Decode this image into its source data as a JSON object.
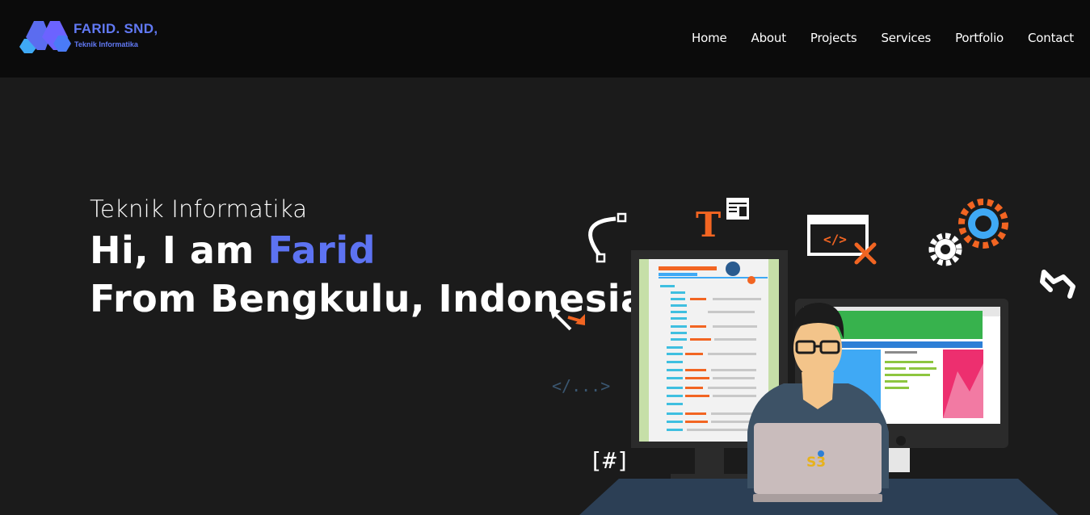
{
  "brand": {
    "title": "FARID. SND,",
    "subtitle": "Teknik Informatika",
    "logo_icon": "m-hexagon-logo-icon"
  },
  "nav": {
    "items": [
      {
        "label": "Home"
      },
      {
        "label": "About"
      },
      {
        "label": "Projects"
      },
      {
        "label": "Services"
      },
      {
        "label": "Portfolio"
      },
      {
        "label": "Contact"
      }
    ]
  },
  "hero": {
    "subtitle": "Teknik Informatika",
    "greeting_prefix": "Hi, I am ",
    "name": "Farid",
    "location_line": "From Bengkulu, Indonesia"
  },
  "illustration": {
    "code_tag_label": "</...>",
    "hash_tag_label": "[#]",
    "text_icon_label": "T",
    "browser_code_label": "</>",
    "laptop_logo_label": "S3"
  },
  "colors": {
    "background": "#1b1b1b",
    "header": "#0b0b0b",
    "accent": "#5d73f2",
    "orange": "#f26522",
    "blue": "#3fa9f5"
  }
}
